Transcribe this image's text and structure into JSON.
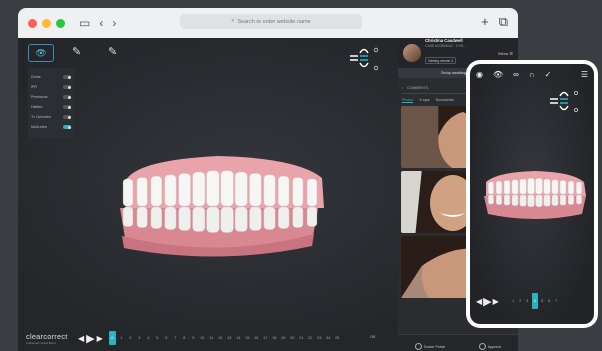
{
  "browser": {
    "url_placeholder": "Search or enter website name",
    "traffic_colors": [
      "#ff5f57",
      "#febc2e",
      "#28c840"
    ]
  },
  "layers": [
    {
      "label": "Gums",
      "on": false
    },
    {
      "label": "IPR",
      "on": false
    },
    {
      "label": "Precisions",
      "on": false
    },
    {
      "label": "Hidden",
      "on": false
    },
    {
      "label": "Tx Overview",
      "on": false
    },
    {
      "label": "Multi-view",
      "on": true
    }
  ],
  "footer": {
    "brand": "clearcorrect",
    "brand_sub": "A Straumann Group Brand",
    "timeline_numbers": [
      "0",
      "1",
      "2",
      "3",
      "4",
      "5",
      "6",
      "7",
      "8",
      "9",
      "10",
      "11",
      "12",
      "13",
      "14",
      "15",
      "16",
      "17",
      "18",
      "19",
      "20",
      "21",
      "22",
      "23",
      "24",
      "25"
    ],
    "active_step": "0",
    "ok_label": "OK"
  },
  "panel": {
    "user_name": "Christina Caudwell",
    "case_id": "CASE #C0855642 · 2 HS…",
    "version_select": "Viewing version 3",
    "menu_label": "Menu",
    "setup_label": "Setup awaiting ap…",
    "comments_label": "COMMENTS",
    "tabs": [
      "Photos",
      "X-rays",
      "Documents"
    ],
    "actions": [
      "Doctor Portal",
      "Approve"
    ]
  },
  "phone": {
    "timeline_numbers": [
      "1",
      "2",
      "3",
      "4",
      "5",
      "6",
      "7"
    ],
    "active_step": "4"
  },
  "colors": {
    "accent": "#2bb3c0",
    "gum": "#e4a0a6"
  }
}
